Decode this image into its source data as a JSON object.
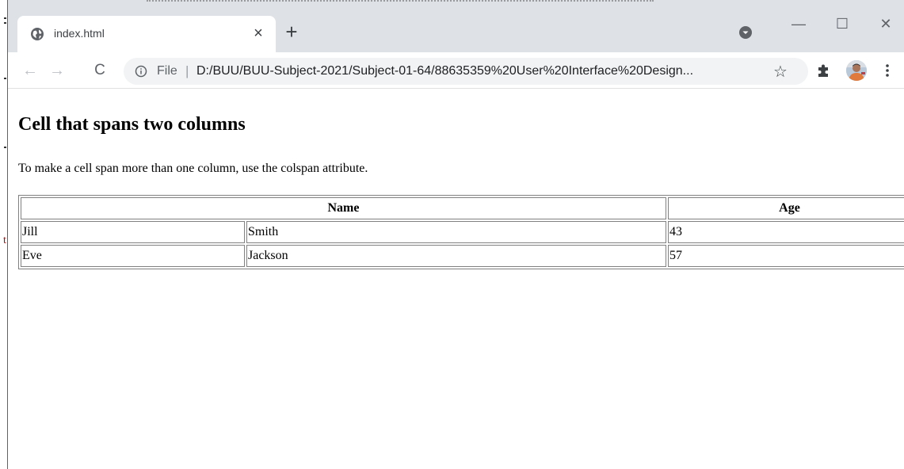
{
  "tab": {
    "title": "index.html",
    "close": "×"
  },
  "new_tab": "+",
  "window": {
    "minimize": "—",
    "maximize": "☐",
    "close": "✕"
  },
  "toolbar": {
    "back": "←",
    "forward": "→",
    "reload": "C",
    "scheme": "File",
    "separator": "|",
    "url": "D:/BUU/BUU-Subject-2021/Subject-01-64/88635359%20User%20Interface%20Design...",
    "star": "☆"
  },
  "page": {
    "title": "Cell that spans two columns",
    "description": "To make a cell span more than one column, use the colspan attribute."
  },
  "table": {
    "headers": [
      "Name",
      "Age"
    ],
    "rows": [
      [
        "Jill",
        "Smith",
        "43"
      ],
      [
        "Eve",
        "Jackson",
        "57"
      ]
    ]
  },
  "background_window": {
    "mark": "t"
  },
  "icons": {
    "favicon": "globe-icon",
    "tab_search": "tab-search-icon",
    "info": "info-icon",
    "extensions": "puzzle-piece-icon",
    "menu": "three-dots-vertical-icon"
  },
  "colors": {
    "tabstrip": "#dee1e6",
    "omnibox": "#f1f3f4",
    "text": "#3c4043"
  }
}
